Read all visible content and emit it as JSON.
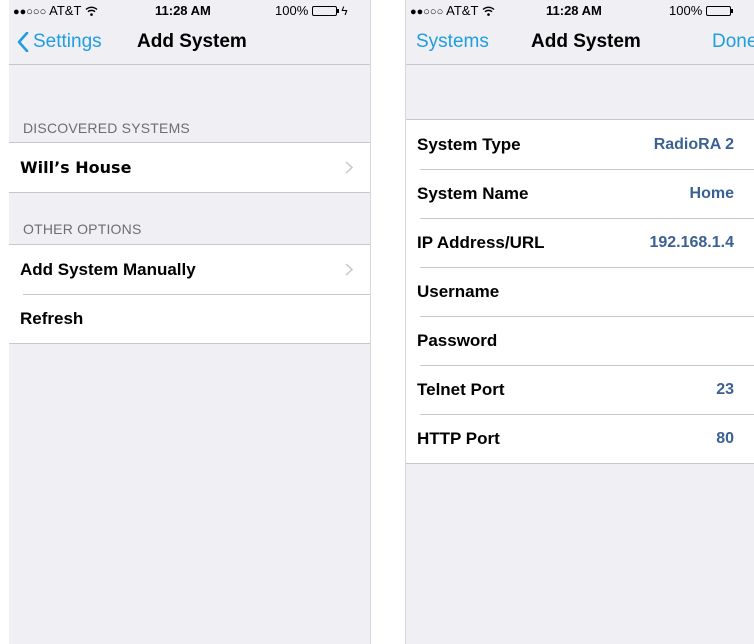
{
  "left_screen": {
    "status": {
      "carrier": "AT&T",
      "signal_dots": "●●○○○",
      "time": "11:28 AM",
      "battery": "100%"
    },
    "nav": {
      "back_label": "Settings",
      "title": "Add System"
    },
    "sections": {
      "discovered_header": "DISCOVERED SYSTEMS",
      "discovered_items": [
        "Will’s House"
      ],
      "other_header": "OTHER OPTIONS",
      "other_items": [
        "Add System Manually",
        "Refresh"
      ]
    }
  },
  "right_screen": {
    "status": {
      "carrier": "AT&T",
      "signal_dots": "●●○○○",
      "time": "11:28 AM",
      "battery": "100%"
    },
    "nav": {
      "back_label": "Systems",
      "title": "Add System",
      "done_label": "Done"
    },
    "fields": [
      {
        "label": "System Type",
        "value": "RadioRA 2"
      },
      {
        "label": "System Name",
        "value": "Home"
      },
      {
        "label": "IP Address/URL",
        "value": "192.168.1.4"
      },
      {
        "label": "Username",
        "value": ""
      },
      {
        "label": "Password",
        "value": ""
      },
      {
        "label": "Telnet Port",
        "value": "23"
      },
      {
        "label": "HTTP Port",
        "value": "80"
      }
    ]
  },
  "colors": {
    "accent": "#1f9ee0",
    "value_text": "#3b6194",
    "background": "#efeff4",
    "separator": "#c8c7cc",
    "battery": "#4cd964"
  },
  "icons": [
    "wifi-icon",
    "battery-icon",
    "charging-bolt-icon",
    "back-chevron-icon",
    "disclosure-chevron-icon"
  ]
}
